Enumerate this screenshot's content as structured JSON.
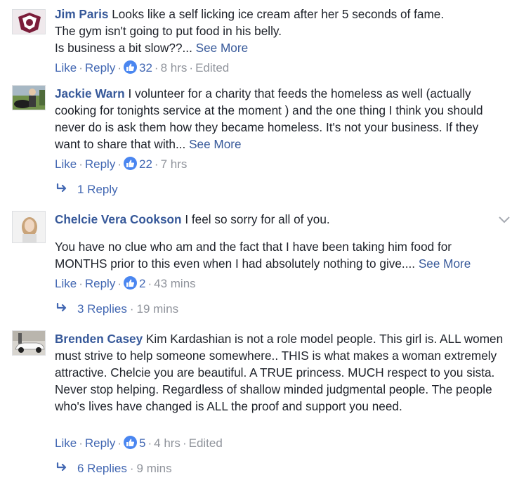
{
  "comments": [
    {
      "author": "Jim Paris",
      "text1": "Looks like a self licking ice cream after her 5 seconds of fame.",
      "text2": "The gym isn't going to put food in his belly.",
      "text3": "Is business a bit slow??...",
      "see_more": "See More",
      "like": "Like",
      "reply": "Reply",
      "reactions": "32",
      "time": "8 hrs",
      "edited": "Edited"
    },
    {
      "author": "Jackie Warn",
      "text": "I volunteer for a charity that feeds the homeless as well (actually cooking for tonights service at the moment ) and the one thing I think you should never do is ask them how they became homeless. It's not your business. If they want to share that with...",
      "see_more": "See More",
      "like": "Like",
      "reply": "Reply",
      "reactions": "22",
      "time": "7 hrs",
      "replies_label": "1 Reply"
    },
    {
      "author": "Chelcie Vera Cookson",
      "text1": "I feel so sorry for all of you.",
      "text2": "You have no clue who am and the fact that I have been taking him food for MONTHS prior to this even when I had absolutely nothing to give....",
      "see_more": "See More",
      "like": "Like",
      "reply": "Reply",
      "reactions": "2",
      "time": "43 mins",
      "replies_label": "3 Replies",
      "replies_time": "19 mins"
    },
    {
      "author": "Brenden Casey",
      "text": "Kim Kardashian is not a role model people. This girl is. ALL women must strive to help someone somewhere.. THIS is what makes a woman extremely attractive. Chelcie you are beautiful. A TRUE princess. MUCH respect to you sista. Never stop helping. Regardless of shallow minded judgmental people. The people who's lives have changed is ALL the proof and support you need.",
      "like": "Like",
      "reply": "Reply",
      "reactions": "5",
      "time": "4 hrs",
      "edited": "Edited",
      "replies_label": "6 Replies",
      "replies_time": "9 mins"
    }
  ],
  "separator": "·",
  "icons": {
    "like": "thumbs-up-icon",
    "reply_arrow": "reply-arrow-icon",
    "options": "chevron-down-icon"
  },
  "colors": {
    "link": "#365899",
    "action": "#4267b2",
    "meta": "#90949c",
    "like_badge": "#4a86f0",
    "text": "#1d2129"
  }
}
